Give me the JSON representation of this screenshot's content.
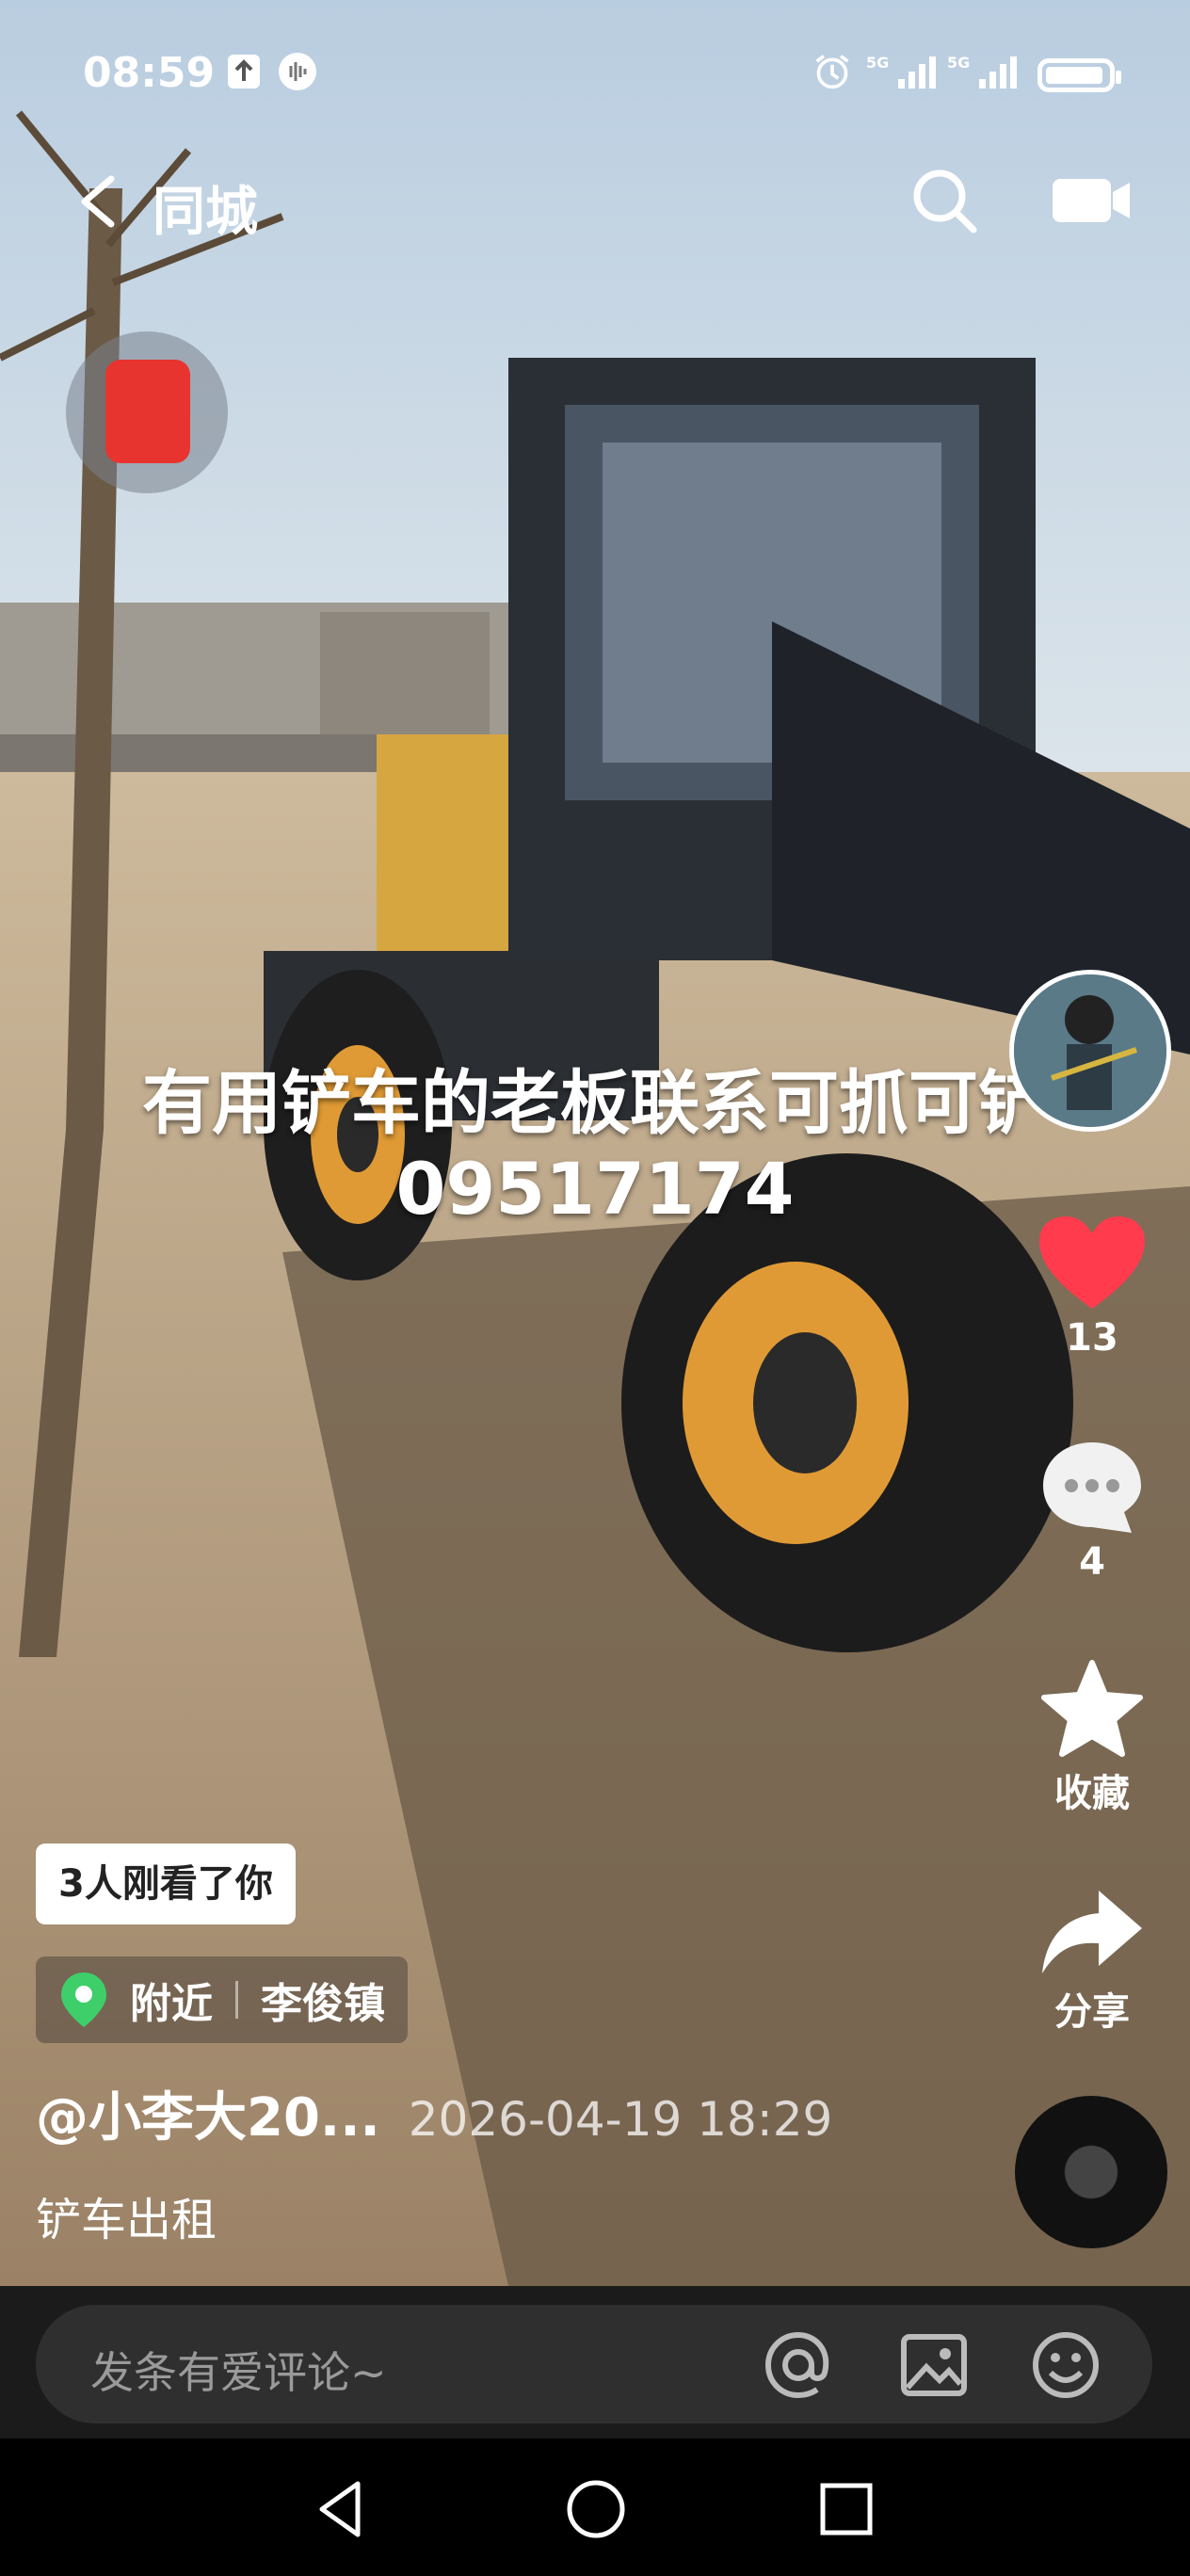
{
  "status": {
    "time": "08:59",
    "signal_label": "5G"
  },
  "nav": {
    "title": "同城"
  },
  "caption": {
    "line1": "有用铲车的老板联系可抓可铲",
    "line2": "09517174"
  },
  "actions": {
    "likes": "13",
    "comments": "4",
    "favorite_label": "收藏",
    "share_label": "分享"
  },
  "info": {
    "viewers": "3人刚看了你",
    "location_tag": "附近",
    "location_name": "李俊镇",
    "author": "@小李大20...",
    "time": "2026-04-19 18:29",
    "description": "铲车出租"
  },
  "comment": {
    "placeholder": "发条有爱评论~"
  },
  "colors": {
    "like": "#ff3b4d",
    "accent_location": "#3ecf6a",
    "comment_bar": "#1b1b1b"
  }
}
